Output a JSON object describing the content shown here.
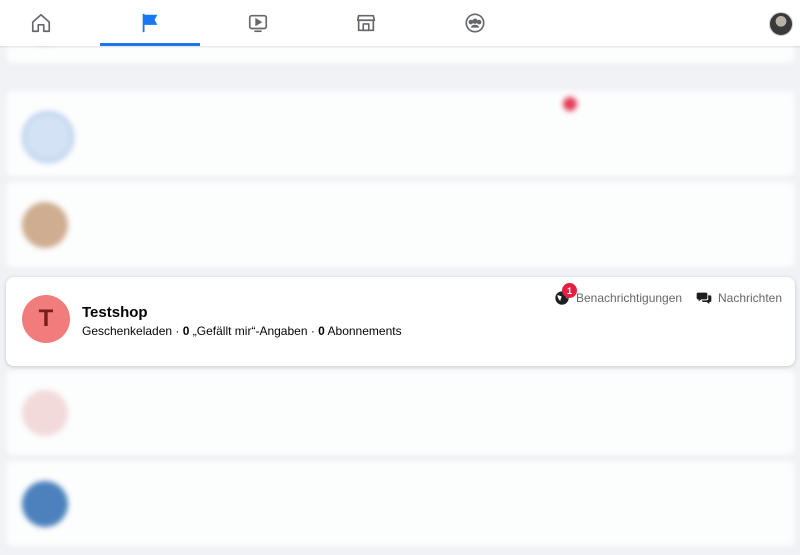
{
  "nav": {
    "tabs": [
      {
        "name": "home",
        "icon": "home-icon"
      },
      {
        "name": "pages",
        "icon": "flag-icon",
        "active": true
      },
      {
        "name": "watch",
        "icon": "video-play-icon"
      },
      {
        "name": "marketplace",
        "icon": "store-icon"
      },
      {
        "name": "groups",
        "icon": "groups-icon"
      }
    ],
    "accent_color": "#1877f2"
  },
  "blurred_rows": [
    {
      "title": "",
      "subtitle": ""
    },
    {
      "title": "",
      "subtitle": ""
    },
    {
      "title": "",
      "subtitle": ""
    },
    {
      "title": "",
      "subtitle": ""
    },
    {
      "title": "",
      "subtitle": ""
    }
  ],
  "card": {
    "avatar_letter": "T",
    "avatar_color": "#f07c7c",
    "name": "Testshop",
    "category": "Geschenkeladen",
    "likes_count": "0",
    "likes_label": "„Gefällt mir“-Angaben",
    "followers_count": "0",
    "followers_label": "Abonnements",
    "notifications_label": "Benachrichtigungen",
    "notifications_badge": "1",
    "messages_label": "Nachrichten",
    "badge_color": "#e41e3f"
  }
}
